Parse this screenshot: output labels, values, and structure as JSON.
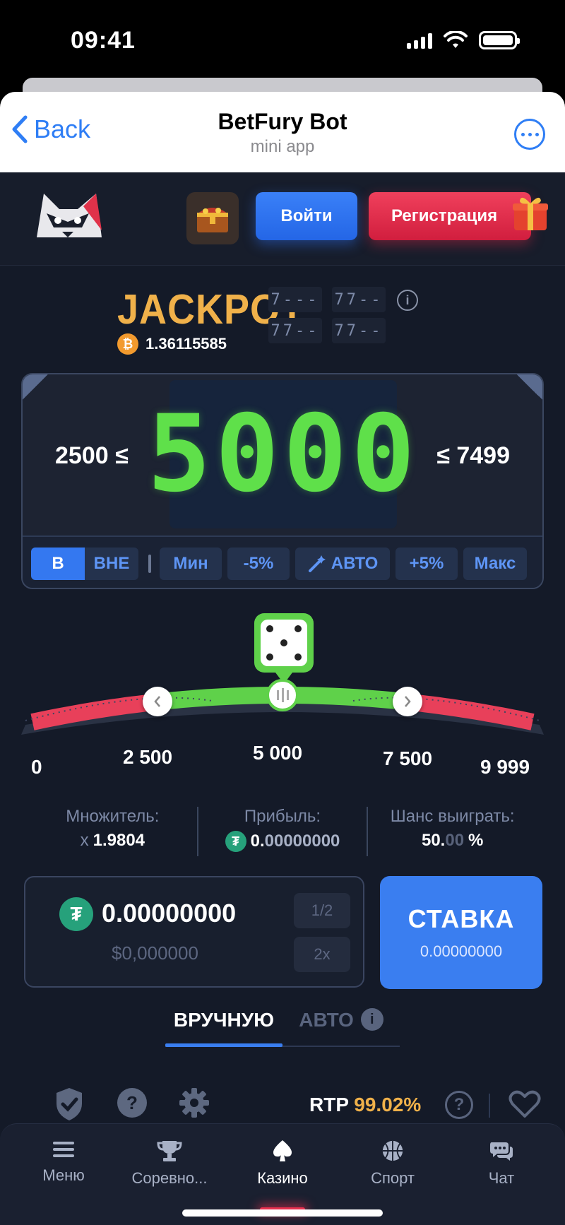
{
  "status_bar": {
    "time": "09:41"
  },
  "telegram": {
    "back_label": "Back",
    "title": "BetFury Bot",
    "subtitle": "mini app"
  },
  "top_bar": {
    "login_label": "Войти",
    "register_label": "Регистрация"
  },
  "jackpot": {
    "title": "JACKPOT",
    "amount": "1.36115585",
    "cells": [
      "7---",
      "77--",
      "77--",
      "77--"
    ],
    "info_label": "i"
  },
  "range": {
    "low_label": "2500 ≤",
    "high_label": "≤ 7499",
    "display_value": "5000",
    "modes": {
      "in": "В",
      "out": "ВНЕ",
      "min": "Мин",
      "minus5": "-5%",
      "auto": "АВТО",
      "plus5": "+5%",
      "max": "Макс"
    }
  },
  "slider": {
    "lower_value": 2500,
    "upper_value": 7499,
    "scale": [
      "0",
      "2 500",
      "5 000",
      "7 500",
      "9 999"
    ],
    "colors": {
      "win": "#5fd14a",
      "lose": "#e8405a"
    }
  },
  "stats": {
    "multiplier_label": "Множитель:",
    "multiplier_prefix": "x",
    "multiplier_value": "1.9804",
    "profit_label": "Прибыль:",
    "profit_int": "0.",
    "profit_dec": "00000000",
    "chance_label": "Шанс выиграть:",
    "chance_int": "50.",
    "chance_dec": "00",
    "chance_unit": "%"
  },
  "bet": {
    "amount": "0.00000000",
    "usd": "$0,000000",
    "half_label": "1/2",
    "double_label": "2x",
    "stake_label": "СТАВКА",
    "stake_amount": "0.00000000"
  },
  "tabs": {
    "manual": "ВРУЧНУЮ",
    "auto": "АВТО",
    "auto_info": "i"
  },
  "tools": {
    "rtp_label": "RTP",
    "rtp_value": "99.02%",
    "help": "?"
  },
  "nav": {
    "menu": "Меню",
    "competitions": "Соревно...",
    "casino": "Казино",
    "sport": "Спорт",
    "chat": "Чат"
  }
}
